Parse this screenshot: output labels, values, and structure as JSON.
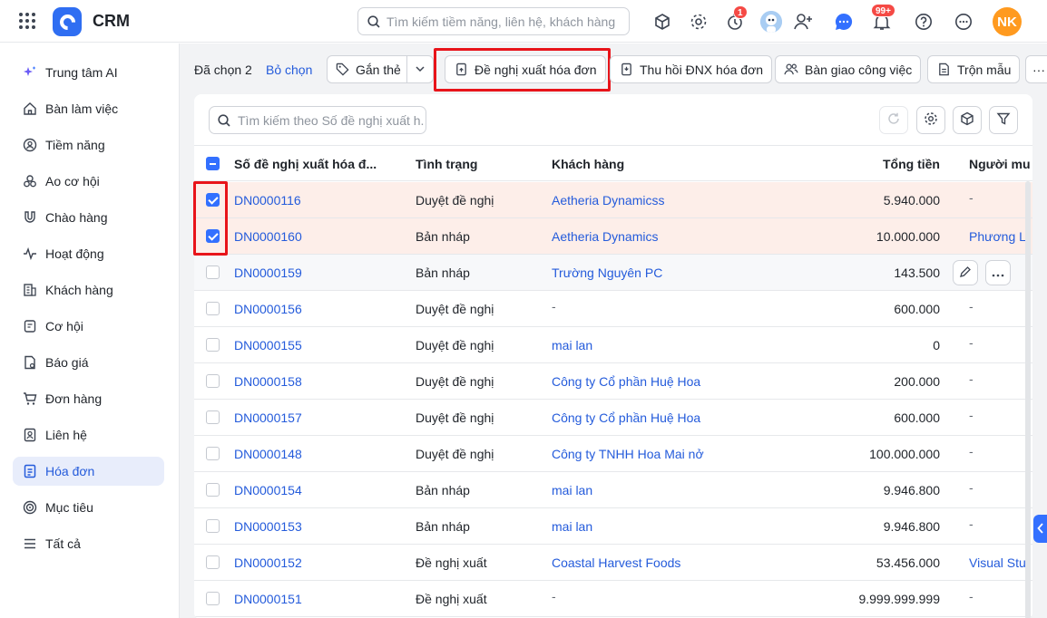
{
  "app": {
    "name": "CRM"
  },
  "search": {
    "placeholder": "Tìm kiếm tiềm năng, liên hệ, khách hàng"
  },
  "header": {
    "notification_badge": "1",
    "bell_badge": "99+",
    "user_initials": "NK",
    "accent": "#2f6ef2",
    "avatar_color": "#ff9a1f"
  },
  "sidebar": {
    "items": [
      {
        "label": "Trung tâm AI",
        "icon": "ai-sparkle-icon"
      },
      {
        "label": "Bàn làm việc",
        "icon": "home-icon"
      },
      {
        "label": "Tiềm năng",
        "icon": "lead-icon"
      },
      {
        "label": "Ao cơ hội",
        "icon": "pool-icon"
      },
      {
        "label": "Chào hàng",
        "icon": "magnet-icon"
      },
      {
        "label": "Hoạt động",
        "icon": "activity-icon"
      },
      {
        "label": "Khách hàng",
        "icon": "building-icon"
      },
      {
        "label": "Cơ hội",
        "icon": "opportunity-icon"
      },
      {
        "label": "Báo giá",
        "icon": "quote-icon"
      },
      {
        "label": "Đơn hàng",
        "icon": "order-icon"
      },
      {
        "label": "Liên hệ",
        "icon": "contact-icon"
      },
      {
        "label": "Hóa đơn",
        "icon": "invoice-icon",
        "active": true
      },
      {
        "label": "Mục tiêu",
        "icon": "target-icon"
      },
      {
        "label": "Tất cả",
        "icon": "menu-icon"
      }
    ]
  },
  "selection_bar": {
    "selected_label": "Đã chọn 2",
    "clear_label": "Bỏ chọn",
    "tag_label": "Gắn thẻ",
    "propose_label": "Đề nghị xuất hóa đơn",
    "revoke_label": "Thu hồi ĐNX hóa đơn",
    "handover_label": "Bàn giao công việc",
    "merge_label": "Trộn mẫu",
    "more_label": "···"
  },
  "table": {
    "search_placeholder": "Tìm kiếm theo Số đề nghị xuất h...",
    "columns": [
      "Số đề nghị xuất hóa đ...",
      "Tình trạng",
      "Khách hàng",
      "Tổng tiền",
      "Người mu"
    ],
    "rows": [
      {
        "code": "DN0000116",
        "status": "Duyệt đề nghị",
        "customer": "Aetheria Dynamicss",
        "customer_link": true,
        "total": "5.940.000",
        "buyer": "-",
        "selected": true
      },
      {
        "code": "DN0000160",
        "status": "Bản nháp",
        "customer": "Aetheria Dynamics",
        "customer_link": true,
        "total": "10.000.000",
        "buyer": "Phương Li",
        "selected": true
      },
      {
        "code": "DN0000159",
        "status": "Bản nháp",
        "customer": "Trường Nguyên PC",
        "customer_link": true,
        "total": "143.500",
        "buyer": "",
        "selected": false,
        "hover": true
      },
      {
        "code": "DN0000156",
        "status": "Duyệt đề nghị",
        "customer": "-",
        "customer_link": false,
        "total": "600.000",
        "buyer": "-",
        "selected": false
      },
      {
        "code": "DN0000155",
        "status": "Duyệt đề nghị",
        "customer": "mai lan",
        "customer_link": true,
        "total": "0",
        "buyer": "-",
        "selected": false
      },
      {
        "code": "DN0000158",
        "status": "Duyệt đề nghị",
        "customer": "Công ty Cổ phần Huệ Hoa",
        "customer_link": true,
        "total": "200.000",
        "buyer": "-",
        "selected": false
      },
      {
        "code": "DN0000157",
        "status": "Duyệt đề nghị",
        "customer": "Công ty Cổ phần Huệ Hoa",
        "customer_link": true,
        "total": "600.000",
        "buyer": "-",
        "selected": false
      },
      {
        "code": "DN0000148",
        "status": "Duyệt đề nghị",
        "customer": "Công ty TNHH Hoa Mai nở",
        "customer_link": true,
        "total": "100.000.000",
        "buyer": "-",
        "selected": false
      },
      {
        "code": "DN0000154",
        "status": "Bản nháp",
        "customer": "mai lan",
        "customer_link": true,
        "total": "9.946.800",
        "buyer": "-",
        "selected": false
      },
      {
        "code": "DN0000153",
        "status": "Bản nháp",
        "customer": "mai lan",
        "customer_link": true,
        "total": "9.946.800",
        "buyer": "-",
        "selected": false
      },
      {
        "code": "DN0000152",
        "status": "Đề nghị xuất",
        "customer": "Coastal Harvest Foods",
        "customer_link": true,
        "total": "53.456.000",
        "buyer": "Visual Stu",
        "selected": false
      },
      {
        "code": "DN0000151",
        "status": "Đề nghị xuất",
        "customer": "-",
        "customer_link": false,
        "total": "9.999.999.999",
        "buyer": "-",
        "selected": false
      }
    ]
  }
}
